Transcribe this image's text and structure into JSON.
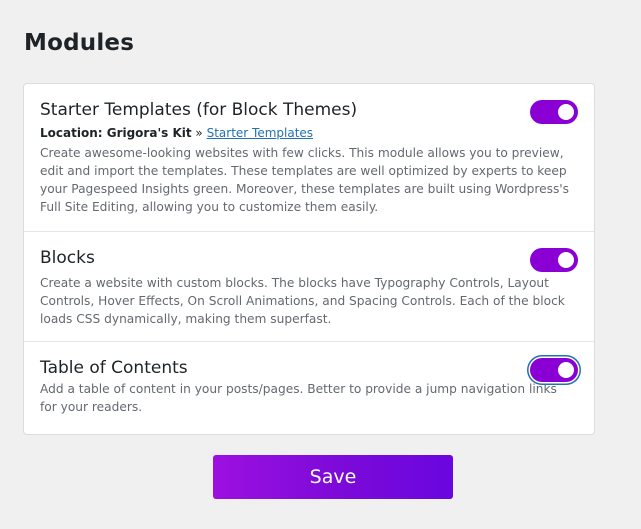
{
  "page": {
    "title": "Modules"
  },
  "modules": [
    {
      "title": "Starter Templates (for Block Themes)",
      "location_label": "Location: Grigora's Kit",
      "location_separator": " » ",
      "location_link": "Starter Templates",
      "description": "Create awesome-looking websites with few clicks. This module allows you to preview, edit and import the templates. These templates are well optimized by experts to keep your Pagespeed Insights green. Moreover, these templates are built using Wordpress's Full Site Editing, allowing you to customize them easily.",
      "enabled": true
    },
    {
      "title": "Blocks",
      "description": "Create a website with custom blocks. The blocks have Typography Controls, Layout Controls, Hover Effects, On Scroll Animations, and Spacing Controls. Each of the block loads CSS dynamically, making them superfast.",
      "enabled": true
    },
    {
      "title": "Table of Contents",
      "description": "Add a table of content in your posts/pages. Better to provide a jump navigation links for your readers.",
      "enabled": true
    }
  ],
  "actions": {
    "save_label": "Save"
  },
  "colors": {
    "accent": "#8a00d4",
    "link": "#2271b1",
    "background": "#f0f0f1"
  }
}
